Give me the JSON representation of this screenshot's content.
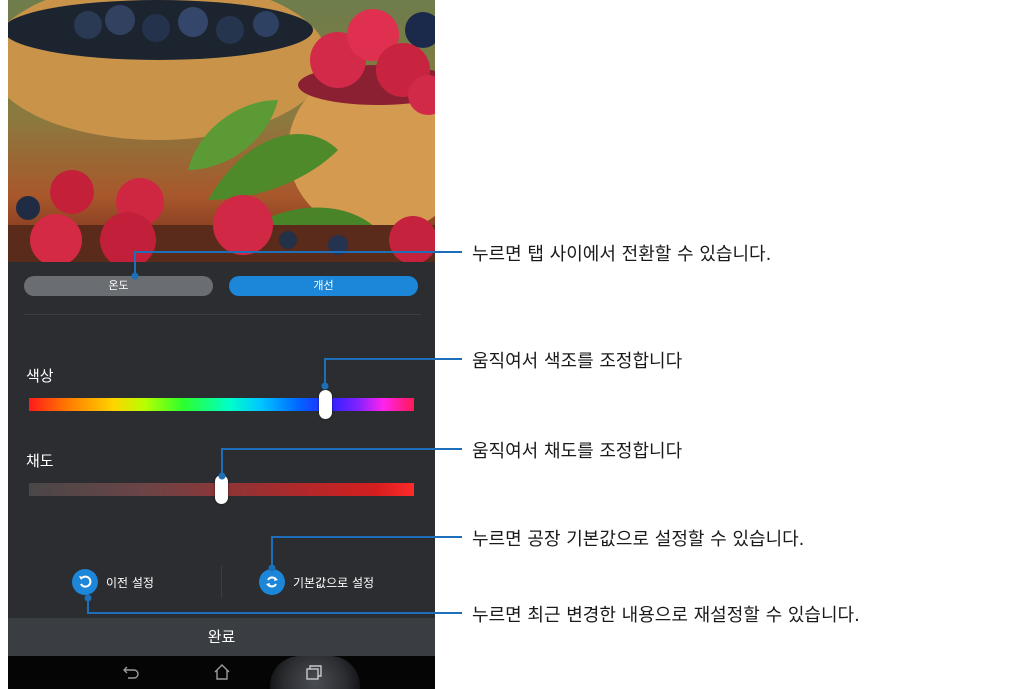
{
  "tabs": {
    "temperature": "온도",
    "enhancement": "개선"
  },
  "sliders": {
    "hue": {
      "label": "색상",
      "position_fraction": 0.77
    },
    "saturation": {
      "label": "채도",
      "position_fraction": 0.5
    }
  },
  "buttons": {
    "previous": "이전 설정",
    "default": "기본값으로 설정",
    "done": "완료"
  },
  "callouts": {
    "tabs": "누르면 탭 사이에서 전환할 수 있습니다.",
    "hue": "움직여서 색조를 조정합니다",
    "saturation": "움직여서 채도를 조정합니다",
    "default": "누르면 공장 기본값으로 설정할 수 있습니다.",
    "previous": "누르면 최근 변경한 내용으로 재설정할 수 있습니다."
  },
  "colors": {
    "accent": "#1c86d8",
    "panel": "#2b2d31",
    "tab_inactive": "#6a6d72"
  },
  "icons": [
    "back-icon",
    "home-icon",
    "recent-apps-icon",
    "undo-icon",
    "refresh-icon"
  ]
}
